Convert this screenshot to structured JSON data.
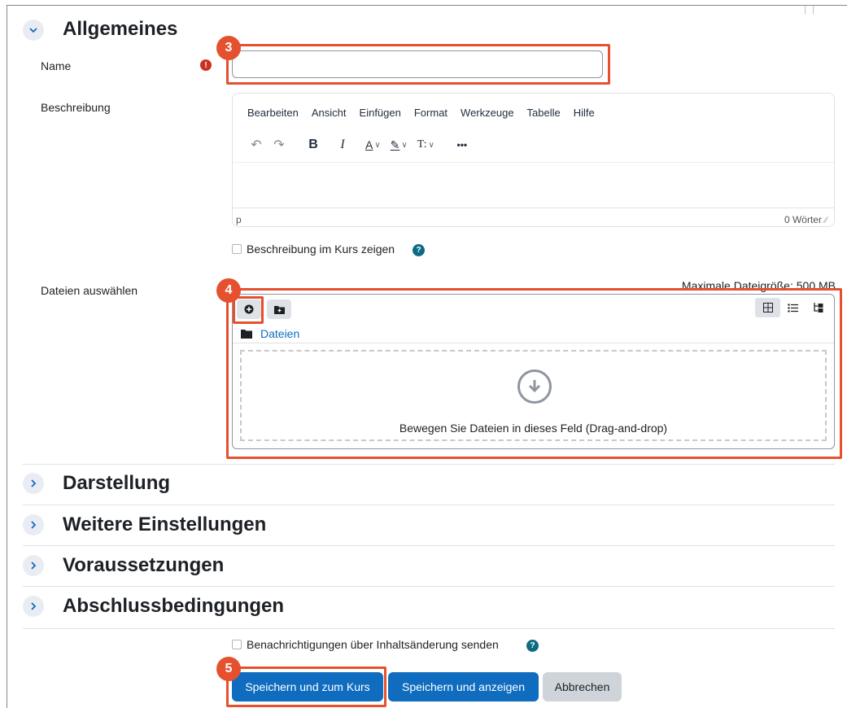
{
  "sections": {
    "general": {
      "title": "Allgemeines",
      "expanded": true
    },
    "appearance": {
      "title": "Darstellung"
    },
    "more_settings": {
      "title": "Weitere Einstellungen"
    },
    "restrictions": {
      "title": "Voraussetzungen"
    },
    "completion": {
      "title": "Abschlussbedingungen"
    }
  },
  "fields": {
    "name_label": "Name",
    "name_value": "",
    "required_mark": "!",
    "description_label": "Beschreibung",
    "files_label": "Dateien auswählen"
  },
  "editor": {
    "menu": [
      "Bearbeiten",
      "Ansicht",
      "Einfügen",
      "Format",
      "Werkzeuge",
      "Tabelle",
      "Hilfe"
    ],
    "toolbar": {
      "undo": "↶",
      "redo": "↷",
      "bold": "B",
      "italic": "I",
      "text_color": "A",
      "highlight": "✎",
      "text_size": "T:",
      "more": "•••"
    },
    "status_path": "p",
    "word_count": "0 Wörter"
  },
  "show_description": {
    "label": "Beschreibung im Kurs zeigen",
    "checked": false,
    "help": "?"
  },
  "filemanager": {
    "max_size": "Maximale Dateigröße: 500 MB",
    "path_label": "Dateien",
    "drop_text": "Bewegen Sie Dateien in dieses Feld (Drag-and-drop)",
    "views": [
      "icons",
      "list",
      "tree"
    ],
    "active_view": "icons"
  },
  "notify": {
    "label": "Benachrichtigungen über Inhaltsänderung senden",
    "checked": false,
    "help": "?"
  },
  "buttons": {
    "save_return": "Speichern und zum Kurs",
    "save_display": "Speichern und anzeigen",
    "cancel": "Abbrechen"
  },
  "annotations": {
    "step_name": "3",
    "step_files": "4",
    "step_save": "5",
    "color": "#e5512f"
  },
  "colors": {
    "primary": "#0f6cbf",
    "required": "#ca3120",
    "help": "#0f6b83"
  }
}
